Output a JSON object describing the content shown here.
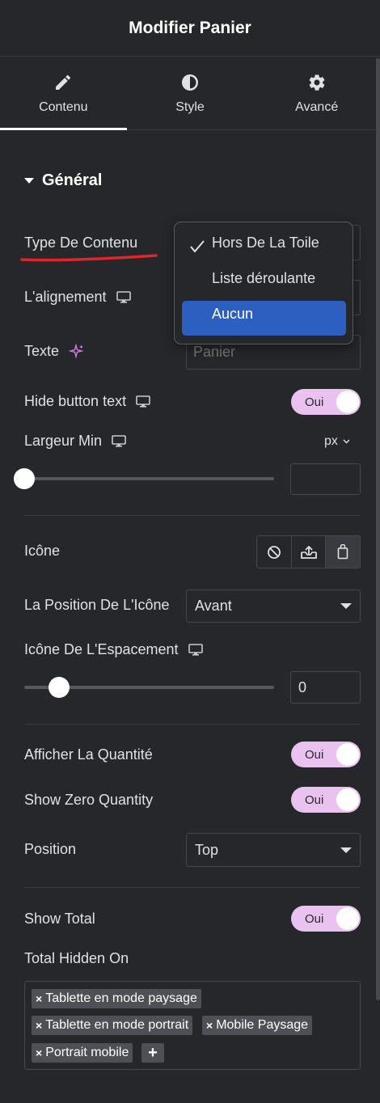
{
  "header": {
    "title": "Modifier Panier"
  },
  "tabs": [
    {
      "label": "Contenu",
      "icon": "pencil-icon",
      "active": true
    },
    {
      "label": "Style",
      "icon": "half-circle-icon",
      "active": false
    },
    {
      "label": "Avancé",
      "icon": "gear-icon",
      "active": false
    }
  ],
  "section": {
    "title": "Général"
  },
  "fields": {
    "content_type": {
      "label": "Type De Contenu"
    },
    "alignment": {
      "label": "L'alignement"
    },
    "text": {
      "label": "Texte",
      "placeholder": "Panier"
    },
    "hide_button_text": {
      "label": "Hide button text",
      "toggle": "Oui"
    },
    "min_width": {
      "label": "Largeur Min",
      "unit": "px",
      "value": ""
    },
    "icon": {
      "label": "Icône"
    },
    "icon_position": {
      "label": "La Position De L'Icône",
      "value": "Avant"
    },
    "icon_spacing": {
      "label": "Icône De L'Espacement",
      "value": "0"
    },
    "show_quantity": {
      "label": "Afficher La Quantité",
      "toggle": "Oui"
    },
    "show_zero_quantity": {
      "label": "Show Zero Quantity",
      "toggle": "Oui"
    },
    "position": {
      "label": "Position",
      "value": "Top"
    },
    "show_total": {
      "label": "Show Total",
      "toggle": "Oui"
    },
    "total_hidden_on": {
      "label": "Total Hidden On",
      "tags": [
        "Tablette en mode paysage",
        "Tablette en mode portrait",
        "Mobile Paysage",
        "Portrait mobile"
      ],
      "add": "+"
    }
  },
  "dropdown": {
    "options": [
      {
        "label": "Hors De La Toile",
        "checked": true,
        "highlighted": false
      },
      {
        "label": "Liste déroulante",
        "checked": false,
        "highlighted": false
      },
      {
        "label": "Aucun",
        "checked": false,
        "highlighted": true
      }
    ]
  },
  "colors": {
    "accent": "#e9c2ef",
    "highlight": "#2c5fbf",
    "annotation": "#e0262a",
    "background": "#26272b"
  }
}
